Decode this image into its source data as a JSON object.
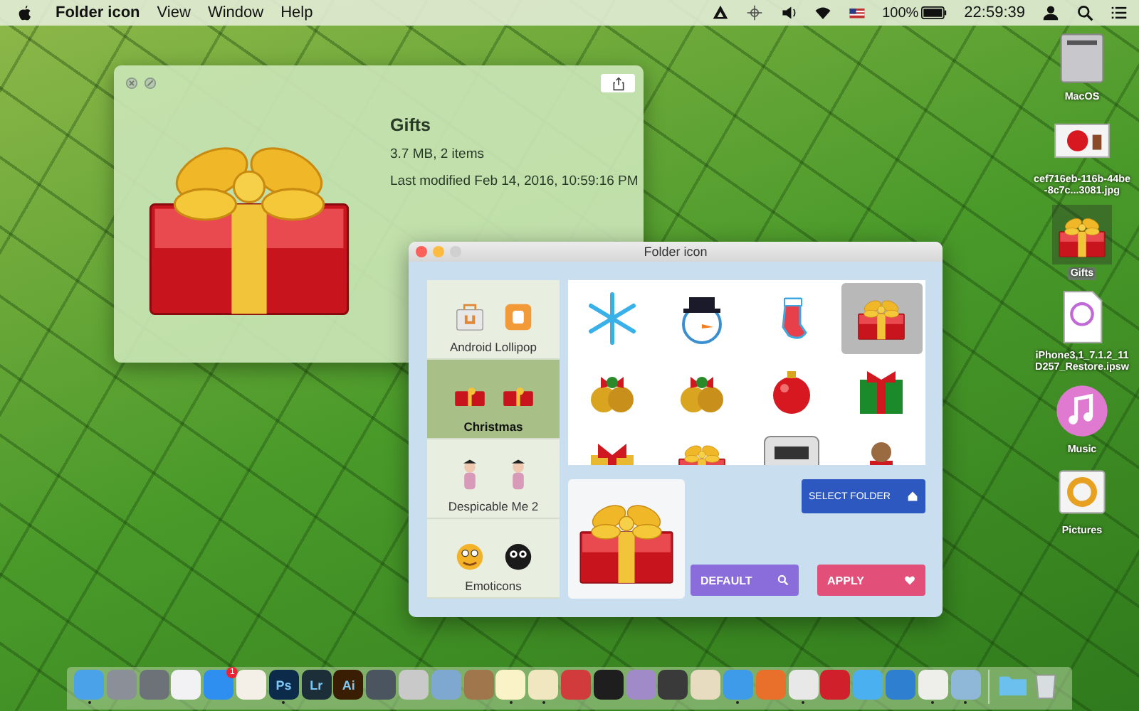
{
  "menu_bar": {
    "app_name": "Folder icon",
    "menus": [
      "View",
      "Window",
      "Help"
    ],
    "battery": "100%",
    "clock": "22:59:39"
  },
  "info_window": {
    "title": "Gifts",
    "size": "3.7 MB, 2 items",
    "modified": "Last modified Feb 14, 2016, 10:59:16 PM"
  },
  "folder_window": {
    "title": "Folder icon",
    "categories": [
      {
        "label": "Android Lollipop",
        "selected": false,
        "kind": "android"
      },
      {
        "label": "Christmas",
        "selected": true,
        "kind": "christmas"
      },
      {
        "label": "Despicable Me 2",
        "selected": false,
        "kind": "cartoon"
      },
      {
        "label": "Emoticons",
        "selected": false,
        "kind": "emoticons"
      }
    ],
    "icons": [
      {
        "kind": "snowflake",
        "selected": false
      },
      {
        "kind": "snowman",
        "selected": false
      },
      {
        "kind": "stocking",
        "selected": false
      },
      {
        "kind": "gift",
        "selected": true
      },
      {
        "kind": "bells",
        "selected": false
      },
      {
        "kind": "bells",
        "selected": false
      },
      {
        "kind": "ornament",
        "selected": false
      },
      {
        "kind": "wrapped-box",
        "selected": false
      },
      {
        "kind": "present",
        "selected": false
      },
      {
        "kind": "gift",
        "selected": false
      },
      {
        "kind": "robot",
        "selected": false
      },
      {
        "kind": "bear",
        "selected": false
      }
    ],
    "select_folder": "SELECT FOLDER",
    "default": "DEFAULT",
    "apply": "APPLY"
  },
  "desktop_icons": [
    {
      "kind": "drive",
      "label": "MacOS",
      "selected": false
    },
    {
      "kind": "image",
      "label": "cef716eb-116b-44be-8c7c...3081.jpg",
      "selected": false
    },
    {
      "kind": "gift",
      "label": "Gifts",
      "selected": true
    },
    {
      "kind": "document",
      "label": "iPhone3,1_7.1.2_11D257_Restore.ipsw",
      "selected": false
    },
    {
      "kind": "music",
      "label": "Music",
      "selected": false
    },
    {
      "kind": "pictures",
      "label": "Pictures",
      "selected": false
    }
  ],
  "dock": [
    {
      "kind": "app",
      "color": "#4aa3e8",
      "running": true
    },
    {
      "kind": "app",
      "color": "#8a8f98",
      "running": false
    },
    {
      "kind": "app",
      "color": "#6d7178",
      "running": false
    },
    {
      "kind": "app",
      "color": "#f2f2f5",
      "running": false
    },
    {
      "kind": "app",
      "color": "#2f8ff0",
      "running": false,
      "badge": "1"
    },
    {
      "kind": "app",
      "color": "#f4f0e8",
      "running": false
    },
    {
      "kind": "app",
      "color": "#0c2a4a",
      "running": true,
      "label": "Ps"
    },
    {
      "kind": "app",
      "color": "#1c2e38",
      "running": false,
      "label": "Lr"
    },
    {
      "kind": "app",
      "color": "#3a1e04",
      "running": false,
      "label": "Ai"
    },
    {
      "kind": "app",
      "color": "#4a5560",
      "running": false
    },
    {
      "kind": "app",
      "color": "#c9c9c9",
      "running": false
    },
    {
      "kind": "app",
      "color": "#7fa8d0",
      "running": false
    },
    {
      "kind": "app",
      "color": "#a0774c",
      "running": false
    },
    {
      "kind": "app",
      "color": "#faf3c8",
      "running": true
    },
    {
      "kind": "app",
      "color": "#f0e6c0",
      "running": true
    },
    {
      "kind": "app",
      "color": "#d23b3b",
      "running": false
    },
    {
      "kind": "app",
      "color": "#1e1e1e",
      "running": false
    },
    {
      "kind": "app",
      "color": "#a08ac8",
      "running": false
    },
    {
      "kind": "app",
      "color": "#3a3a3a",
      "running": false
    },
    {
      "kind": "app",
      "color": "#e8dcc0",
      "running": false
    },
    {
      "kind": "app",
      "color": "#3d9be9",
      "running": true
    },
    {
      "kind": "app",
      "color": "#e8702a",
      "running": false
    },
    {
      "kind": "app",
      "color": "#e8e8e8",
      "running": true
    },
    {
      "kind": "app",
      "color": "#d0202c",
      "running": false
    },
    {
      "kind": "app",
      "color": "#4ab0f0",
      "running": false
    },
    {
      "kind": "app",
      "color": "#2e7fd0",
      "running": false
    },
    {
      "kind": "app",
      "color": "#eeeeea",
      "running": true
    },
    {
      "kind": "app",
      "color": "#8fb8d8",
      "running": true
    },
    {
      "kind": "folder",
      "color": "#6cc0ee",
      "running": false
    },
    {
      "kind": "trash",
      "color": "#d8dde0",
      "running": false
    }
  ]
}
